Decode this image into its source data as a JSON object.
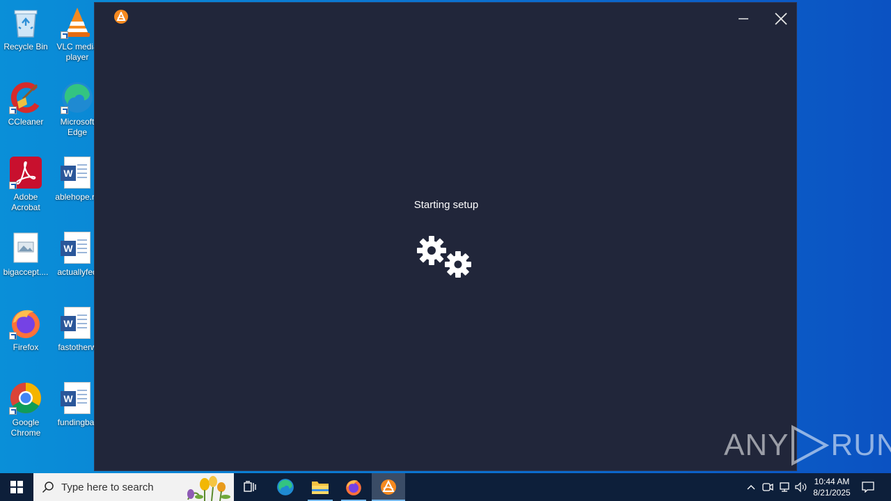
{
  "desktop": {
    "icons": [
      {
        "label": "Recycle Bin",
        "icon": "recycle-bin-icon"
      },
      {
        "label": "VLC media player",
        "icon": "vlc-icon"
      },
      {
        "label": "CCleaner",
        "icon": "ccleaner-icon"
      },
      {
        "label": "Microsoft Edge",
        "icon": "edge-icon"
      },
      {
        "label": "Adobe Acrobat",
        "icon": "acrobat-icon"
      },
      {
        "label": "ablehope.rtf",
        "icon": "word-doc-icon"
      },
      {
        "label": "bigaccept....",
        "icon": "image-file-icon"
      },
      {
        "label": "actuallyfed",
        "icon": "word-doc-icon"
      },
      {
        "label": "Firefox",
        "icon": "firefox-icon"
      },
      {
        "label": "fastotherw",
        "icon": "word-doc-icon"
      },
      {
        "label": "Google Chrome",
        "icon": "chrome-icon"
      },
      {
        "label": "fundingbar",
        "icon": "word-doc-icon"
      }
    ]
  },
  "installer": {
    "status": "Starting setup",
    "accent": "#f5891f",
    "background": "#21263a"
  },
  "watermark": {
    "left": "ANY",
    "right": "RUN"
  },
  "taskbar": {
    "search_placeholder": "Type here to search",
    "apps": [
      {
        "name": "Task View",
        "icon": "task-view-icon"
      },
      {
        "name": "Microsoft Edge",
        "icon": "edge-icon"
      },
      {
        "name": "File Explorer",
        "icon": "file-explorer-icon"
      },
      {
        "name": "Firefox",
        "icon": "firefox-icon"
      },
      {
        "name": "Installer",
        "icon": "installer-app-icon"
      }
    ],
    "clock": {
      "time": "10:44 AM",
      "date": "8/21/2025"
    }
  }
}
